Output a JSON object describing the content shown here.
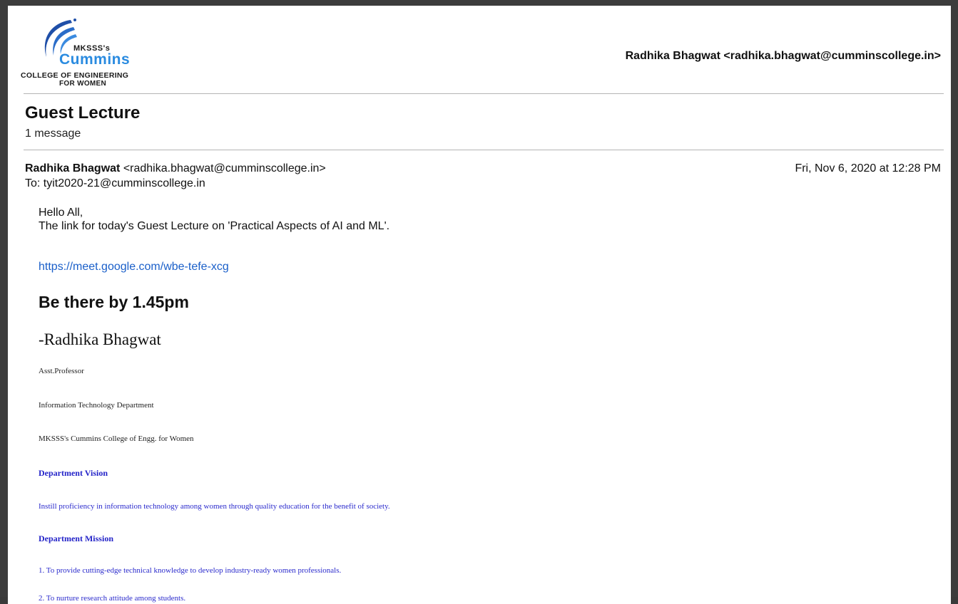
{
  "logo": {
    "mksss": "MKSSS's",
    "cummins": "Cummins",
    "college": "COLLEGE OF ENGINEERING",
    "women": "FOR WOMEN"
  },
  "header": {
    "account": "Radhika Bhagwat <radhika.bhagwat@cumminscollege.in>"
  },
  "thread": {
    "subject": "Guest Lecture",
    "count": "1 message"
  },
  "message": {
    "from_name": "Radhika Bhagwat",
    "from_email": "<radhika.bhagwat@cumminscollege.in>",
    "to": "To: tyit2020-21@cumminscollege.in",
    "date": "Fri, Nov 6, 2020 at 12:28 PM",
    "greeting": "Hello All,",
    "intro": "The link for today's Guest Lecture on 'Practical Aspects of AI and ML'.",
    "link": "https://meet.google.com/wbe-tefe-xcg",
    "emphasis": "Be there by 1.45pm",
    "signature_name": "-Radhika Bhagwat",
    "title": "Asst.Professor",
    "department": "Information Technology Department",
    "institution": "MKSSS's Cummins College of Engg. for Women",
    "vision_heading": "Department Vision",
    "vision_text": "Instill proficiency in information technology among women through quality education for the benefit of society.",
    "mission_heading": "Department Mission",
    "mission_1": "1. To provide cutting-edge technical knowledge to develop industry-ready women professionals.",
    "mission_2": "2. To nurture research attitude among students."
  },
  "colors": {
    "link": "#1a5fc9",
    "signature_blue": "#2323c8",
    "brand_blue": "#2a8be0"
  }
}
